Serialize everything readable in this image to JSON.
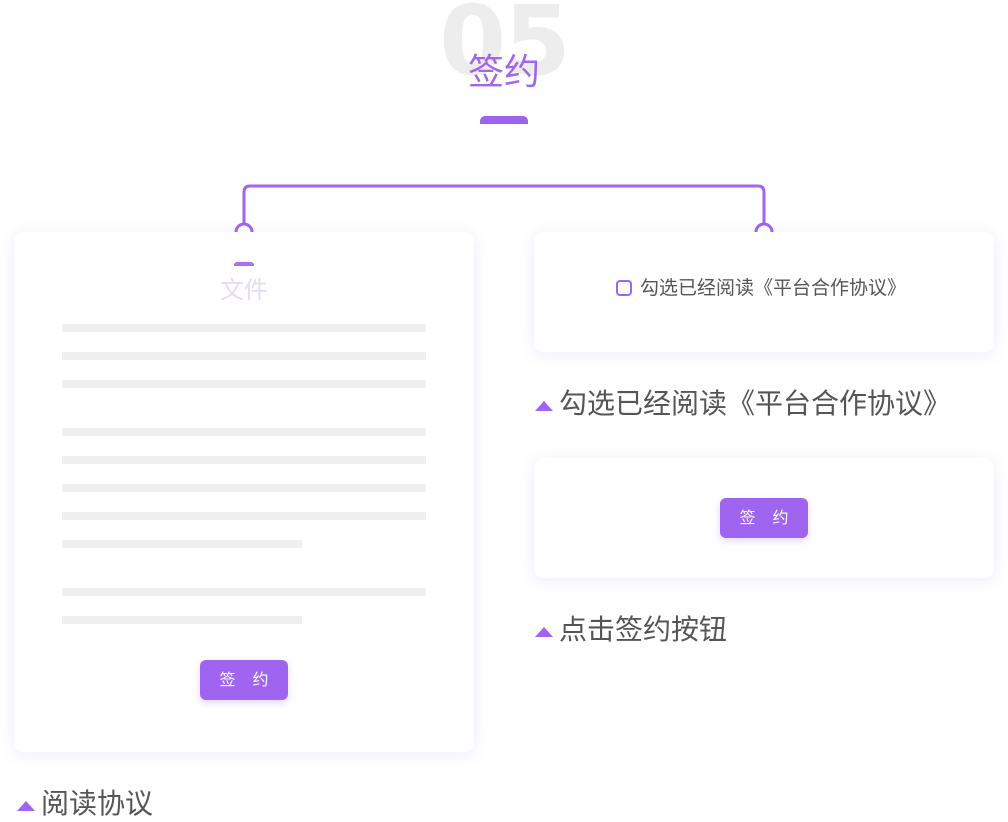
{
  "header": {
    "step_number": "05",
    "step_title": "签约"
  },
  "document_card": {
    "title": "文件",
    "sign_button_label": "签 约"
  },
  "agreement_card": {
    "checkbox_label": "勾选已经阅读《平台合作协议》",
    "checked": false
  },
  "button_card": {
    "sign_button_label": "签 约"
  },
  "captions": {
    "check_agreement": "勾选已经阅读《平台合作协议》",
    "click_sign": "点击签约按钮",
    "read_agreement": "阅读协议"
  },
  "icons": {
    "caption_marker": "triangle-up-icon",
    "connector_node": "circle-node-icon"
  },
  "colors": {
    "accent": "#9f65f0",
    "step_number": "#ededed",
    "doc_title": "#e5daf7",
    "placeholder_line": "#efefef",
    "text": "#555555"
  }
}
